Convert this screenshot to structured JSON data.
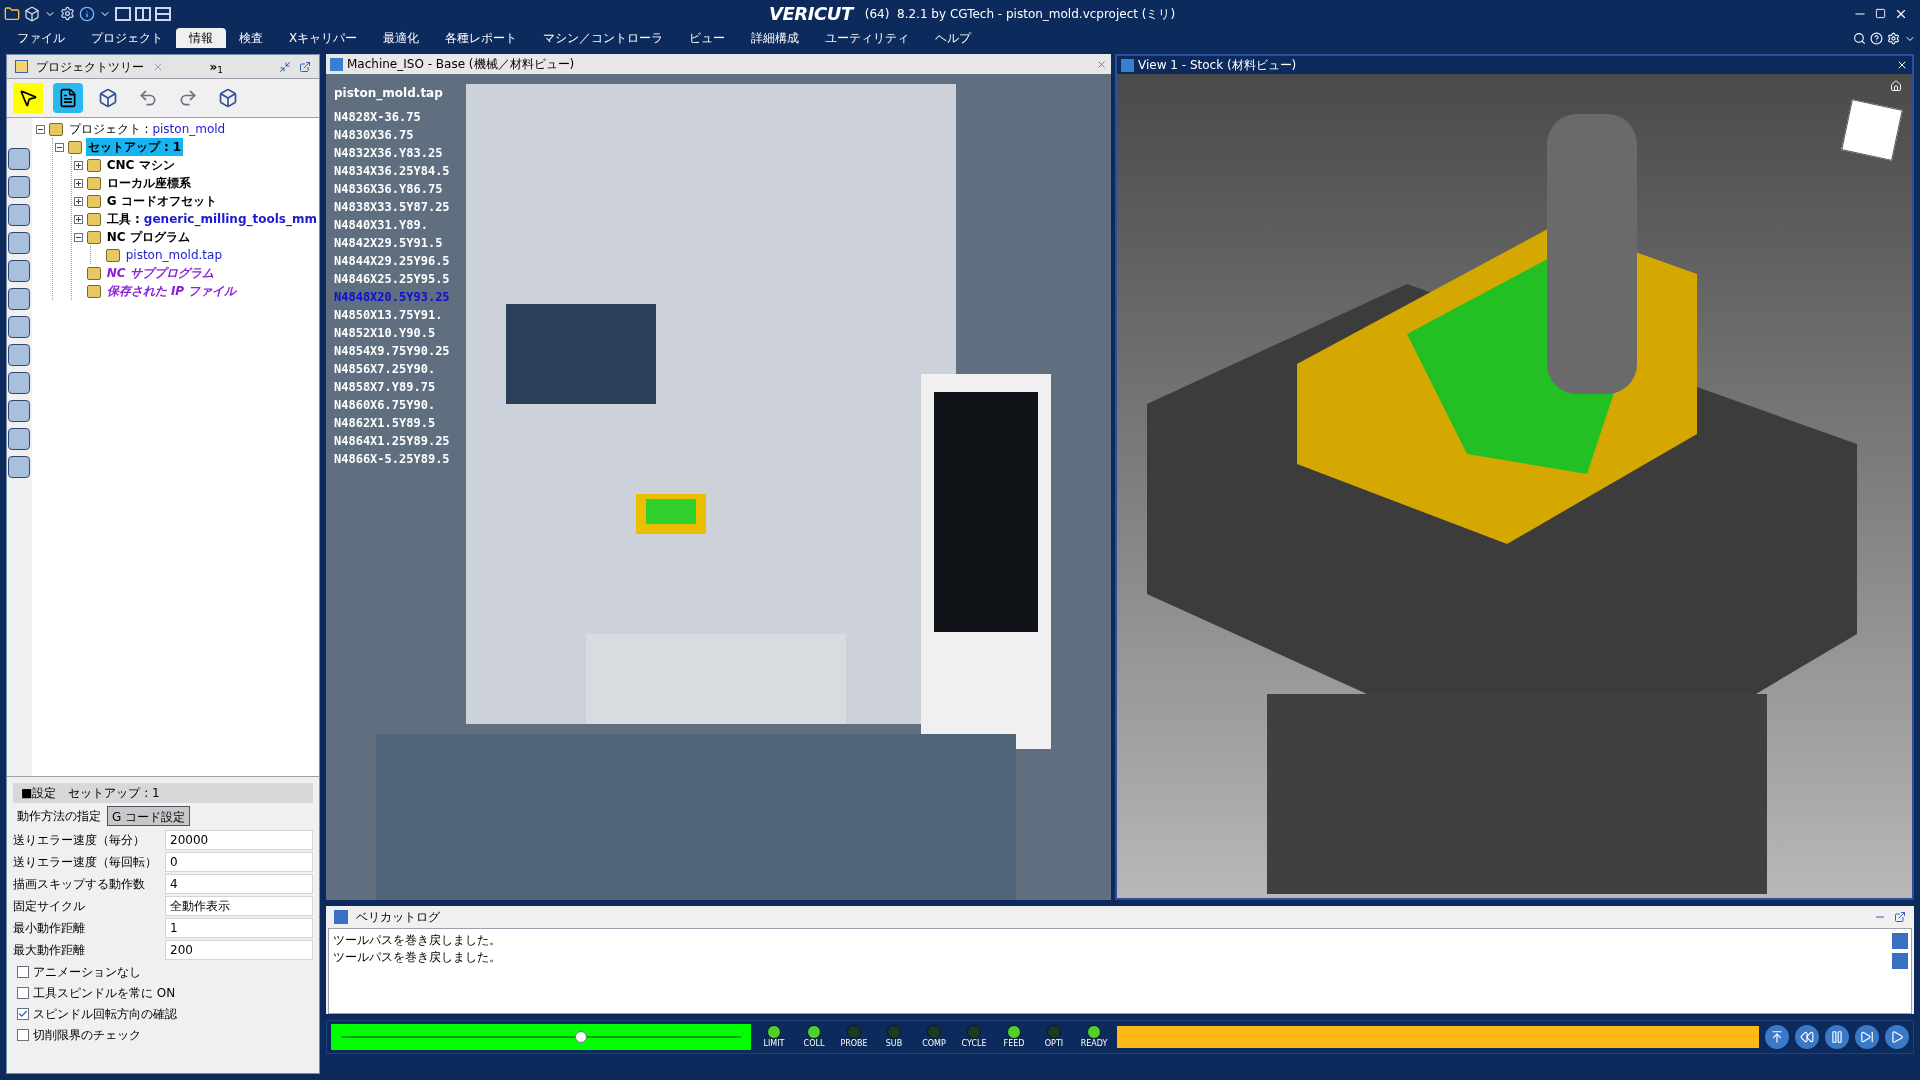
{
  "title_bar": {
    "logo": "VERICUT",
    "title": "(64)  8.2.1 by CGTech - piston_mold.vcproject (ミリ)"
  },
  "menu": [
    {
      "label": "ファイル",
      "selected": false
    },
    {
      "label": "プロジェクト",
      "selected": false
    },
    {
      "label": "情報",
      "selected": true
    },
    {
      "label": "検査",
      "selected": false
    },
    {
      "label": "Xキャリパー",
      "selected": false
    },
    {
      "label": "最適化",
      "selected": false
    },
    {
      "label": "各種レポート",
      "selected": false
    },
    {
      "label": "マシン／コントローラ",
      "selected": false
    },
    {
      "label": "ビュー",
      "selected": false
    },
    {
      "label": "詳細構成",
      "selected": false
    },
    {
      "label": "ユーティリティ",
      "selected": false
    },
    {
      "label": "ヘルプ",
      "selected": false
    }
  ],
  "project_panel": {
    "tab": "プロジェクトツリー",
    "overflow": "»",
    "overflow_count": "1",
    "tree": [
      {
        "label": "プロジェクト : ",
        "value": "piston_mold",
        "selected": false,
        "expanded": true,
        "children": [
          {
            "label": "セットアップ : 1",
            "kind": "bold",
            "selected": true,
            "expanded": true,
            "children": [
              {
                "label": "CNC マシン",
                "kind": "bold",
                "selected": false,
                "expanded": false
              },
              {
                "label": "ローカル座標系",
                "kind": "bold",
                "selected": false,
                "expanded": false
              },
              {
                "label": "G コードオフセット",
                "kind": "bold",
                "selected": false,
                "expanded": false
              },
              {
                "label": "工具 : ",
                "value": "generic_milling_tools_mm",
                "kind": "bold",
                "selected": false,
                "expanded": false
              },
              {
                "label": "NC プログラム",
                "kind": "bold",
                "selected": false,
                "expanded": true,
                "children": [
                  {
                    "value": "piston_mold.tap",
                    "selected": false
                  }
                ]
              },
              {
                "label": "NC サブプログラム",
                "kind": "empty",
                "selected": false
              },
              {
                "label": "保存された IP ファイル",
                "kind": "empty",
                "selected": false
              }
            ]
          }
        ]
      }
    ]
  },
  "settings": {
    "title": "■設定",
    "subtitle": "セットアップ : 1",
    "tabs": [
      {
        "label": "動作方法の指定",
        "selected": true
      },
      {
        "label": "G コード設定",
        "selected": false
      }
    ],
    "fields": [
      {
        "label": "送りエラー速度（毎分）",
        "value": "20000"
      },
      {
        "label": "送りエラー速度（毎回転）",
        "value": "0"
      },
      {
        "label": "描画スキップする動作数",
        "value": "4"
      },
      {
        "label": "固定サイクル",
        "value": "全動作表示"
      },
      {
        "label": "最小動作距離",
        "value": "1"
      },
      {
        "label": "最大動作距離",
        "value": "200"
      }
    ],
    "checkboxes": [
      {
        "label": "アニメーションなし",
        "checked": false
      },
      {
        "label": "工具スピンドルを常に ON",
        "checked": false
      },
      {
        "label": "スピンドル回転方向の確認",
        "checked": true
      },
      {
        "label": "切削限界のチェック",
        "checked": false
      }
    ]
  },
  "machine_view": {
    "title": "Machine_ISO - Base (機械／材料ビュー)",
    "program": "piston_mold.tap",
    "code": [
      {
        "text": "N4828X-36.75",
        "selected": false
      },
      {
        "text": "N4830X36.75",
        "selected": false
      },
      {
        "text": "N4832X36.Y83.25",
        "selected": false
      },
      {
        "text": "N4834X36.25Y84.5",
        "selected": false
      },
      {
        "text": "N4836X36.Y86.75",
        "selected": false
      },
      {
        "text": "N4838X33.5Y87.25",
        "selected": false
      },
      {
        "text": "N4840X31.Y89.",
        "selected": false
      },
      {
        "text": "N4842X29.5Y91.5",
        "selected": false
      },
      {
        "text": "N4844X29.25Y96.5",
        "selected": false
      },
      {
        "text": "N4846X25.25Y95.5",
        "selected": false
      },
      {
        "text": "N4848X20.5Y93.25",
        "selected": true
      },
      {
        "text": "N4850X13.75Y91.",
        "selected": false
      },
      {
        "text": "N4852X10.Y90.5",
        "selected": false
      },
      {
        "text": "N4854X9.75Y90.25",
        "selected": false
      },
      {
        "text": "N4856X7.25Y90.",
        "selected": false
      },
      {
        "text": "N4858X7.Y89.75",
        "selected": false
      },
      {
        "text": "N4860X6.75Y90.",
        "selected": false
      },
      {
        "text": "N4862X1.5Y89.5",
        "selected": false
      },
      {
        "text": "N4864X1.25Y89.25",
        "selected": false
      },
      {
        "text": "N4866X-5.25Y89.5",
        "selected": false
      }
    ]
  },
  "stock_view": {
    "title": "View 1 - Stock (材料ビュー)"
  },
  "log": {
    "tab": "ベリカットログ",
    "lines": [
      "ツールパスを巻き戻しました。",
      "ツールパスを巻き戻しました。"
    ]
  },
  "status": {
    "progress": {
      "level": 0.6
    },
    "lights": [
      {
        "label": "LIMIT",
        "on": true
      },
      {
        "label": "COLL",
        "on": true
      },
      {
        "label": "PROBE",
        "on": false
      },
      {
        "label": "SUB",
        "on": false
      },
      {
        "label": "COMP",
        "on": false
      },
      {
        "label": "CYCLE",
        "on": false
      },
      {
        "label": "FEED",
        "on": true
      },
      {
        "label": "OPTI",
        "on": false
      },
      {
        "label": "READY",
        "on": true
      }
    ]
  }
}
